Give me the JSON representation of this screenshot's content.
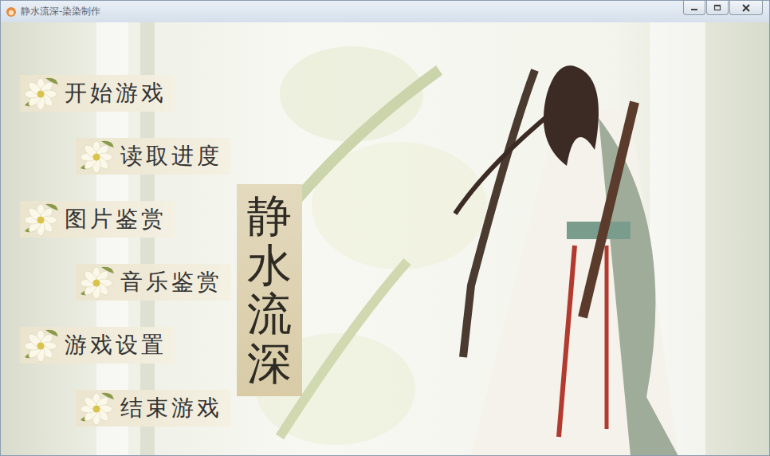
{
  "window": {
    "title": "静水流深-染染制作"
  },
  "menu": [
    {
      "label": "开始游戏"
    },
    {
      "label": "读取进度"
    },
    {
      "label": "图片鉴赏"
    },
    {
      "label": "音乐鉴赏"
    },
    {
      "label": "游戏设置"
    },
    {
      "label": "结束游戏"
    }
  ],
  "logo": {
    "title": "静水流深"
  }
}
